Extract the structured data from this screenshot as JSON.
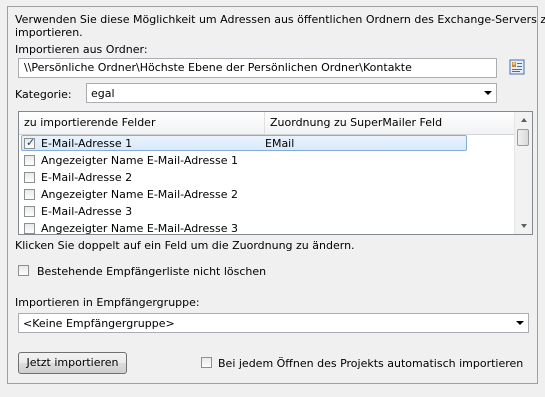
{
  "intro_text_line1": "Verwenden Sie diese Möglichkeit um Adressen aus öffentlichen Ordnern des Exchange-Servers zu",
  "intro_text_line2": "importieren.",
  "folder": {
    "label": "Importieren aus Ordner:",
    "value": "\\\\Persönliche Ordner\\Höchste Ebene der Persönlichen Ordner\\Kontakte"
  },
  "category": {
    "label": "Kategorie:",
    "value": "egal"
  },
  "fields_list": {
    "headers": [
      "zu importierende Felder",
      "Zuordnung zu SuperMailer Feld"
    ],
    "rows": [
      {
        "field": "E-Mail-Adresse 1",
        "mapping": "EMail",
        "checked": true,
        "selected": true
      },
      {
        "field": "Angezeigter Name E-Mail-Adresse 1",
        "mapping": "",
        "checked": false,
        "selected": false
      },
      {
        "field": "E-Mail-Adresse 2",
        "mapping": "",
        "checked": false,
        "selected": false
      },
      {
        "field": "Angezeigter Name E-Mail-Adresse 2",
        "mapping": "",
        "checked": false,
        "selected": false
      },
      {
        "field": "E-Mail-Adresse 3",
        "mapping": "",
        "checked": false,
        "selected": false
      },
      {
        "field": "Angezeigter Name E-Mail-Adresse 3",
        "mapping": "",
        "checked": false,
        "selected": false
      }
    ]
  },
  "hint_text": "Klicken Sie doppelt auf ein Feld um die Zuordnung zu ändern.",
  "keep_list": {
    "label": "Bestehende Empfängerliste nicht löschen",
    "checked": false
  },
  "group": {
    "label": "Importieren in Empfängergruppe:",
    "value": "<Keine Empfängergruppe>"
  },
  "import_button_label": "Jetzt importieren",
  "auto_import": {
    "label": "Bei jedem Öffnen des Projekts automatisch importieren",
    "checked": false
  },
  "icons": {
    "folder_browse": "address-book-icon",
    "dropdown": "chevron-down-icon"
  }
}
